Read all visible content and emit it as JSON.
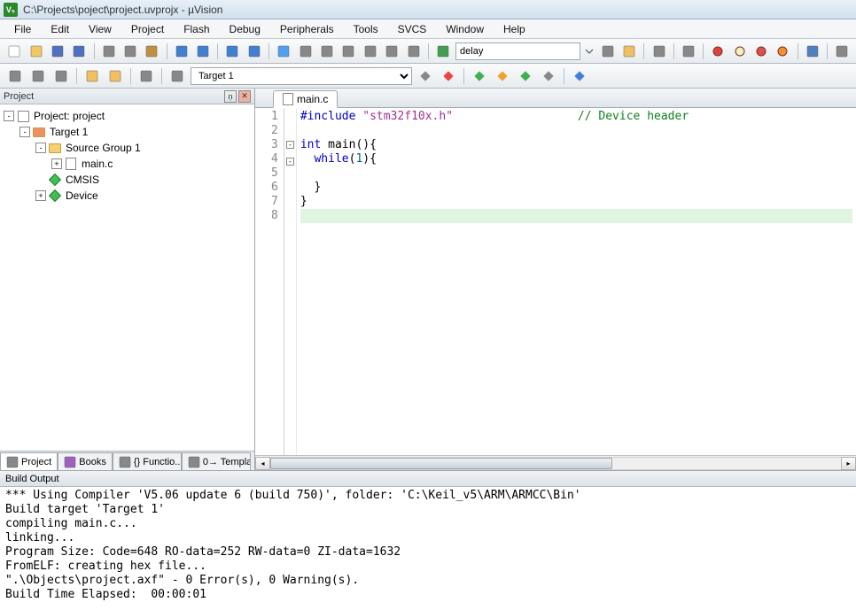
{
  "title": "C:\\Projects\\poject\\project.uvprojx - µVision",
  "menu": [
    "File",
    "Edit",
    "View",
    "Project",
    "Flash",
    "Debug",
    "Peripherals",
    "Tools",
    "SVCS",
    "Window",
    "Help"
  ],
  "toolbar1": {
    "combo_value": "delay",
    "icons": [
      "new",
      "open",
      "save",
      "save-all",
      "cut",
      "copy",
      "paste",
      "undo",
      "redo",
      "back",
      "forward",
      "bookmark",
      "indent",
      "outdent",
      "indent2",
      "comment",
      "uncomment",
      "brace",
      "macro",
      "find",
      "find-files",
      "search",
      "config",
      "dot-red",
      "dot-yellow",
      "dot-green",
      "dot-orange",
      "window",
      "wrench"
    ]
  },
  "toolbar2": {
    "target": "Target 1"
  },
  "project_panel": {
    "title": "Project",
    "pin": "📌",
    "close": "✕",
    "tree": [
      {
        "indent": 0,
        "expand": "-",
        "icon": "proj",
        "label": "Project: project"
      },
      {
        "indent": 1,
        "expand": "-",
        "icon": "folder-red",
        "label": "Target 1"
      },
      {
        "indent": 2,
        "expand": "-",
        "icon": "folder",
        "label": "Source Group 1"
      },
      {
        "indent": 3,
        "expand": "+",
        "icon": "file",
        "label": "main.c"
      },
      {
        "indent": 2,
        "expand": "",
        "icon": "diamond",
        "label": "CMSIS"
      },
      {
        "indent": 2,
        "expand": "+",
        "icon": "diamond",
        "label": "Device"
      }
    ],
    "tabs": [
      {
        "icon": "proj",
        "label": "Project",
        "active": true
      },
      {
        "icon": "books",
        "label": "Books"
      },
      {
        "icon": "func",
        "label": "{} Functio..."
      },
      {
        "icon": "tmpl",
        "label": "0→ Templat..."
      }
    ]
  },
  "editor": {
    "tab": "main.c",
    "lines": [
      {
        "n": 1,
        "html": "<span class='kw'>#include</span> <span class='str'>\"stm32f10x.h\"</span>                  <span class='cmt'>// Device header</span>"
      },
      {
        "n": 2,
        "html": ""
      },
      {
        "n": 3,
        "html": "<span class='kw'>int</span> main(){",
        "fold": "-"
      },
      {
        "n": 4,
        "html": "  <span class='kw'>while</span>(<span class='num'>1</span>){",
        "fold": "-"
      },
      {
        "n": 5,
        "html": ""
      },
      {
        "n": 6,
        "html": "  }"
      },
      {
        "n": 7,
        "html": "}"
      },
      {
        "n": 8,
        "html": "",
        "hl": true
      }
    ]
  },
  "output": {
    "title": "Build Output",
    "lines": [
      "*** Using Compiler 'V5.06 update 6 (build 750)', folder: 'C:\\Keil_v5\\ARM\\ARMCC\\Bin'",
      "Build target 'Target 1'",
      "compiling main.c...",
      "linking...",
      "Program Size: Code=648 RO-data=252 RW-data=0 ZI-data=1632",
      "FromELF: creating hex file...",
      "\".\\Objects\\project.axf\" - 0 Error(s), 0 Warning(s).",
      "Build Time Elapsed:  00:00:01"
    ]
  }
}
